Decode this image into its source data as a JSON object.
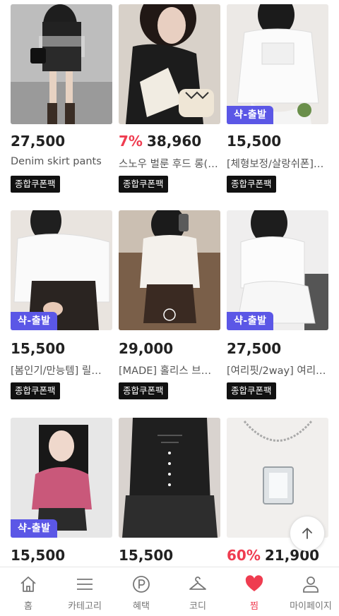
{
  "products": [
    {
      "price": "27,500",
      "discount": "",
      "title": "Denim skirt pants",
      "coupon": "종합쿠폰팩",
      "badge": ""
    },
    {
      "price": "38,960",
      "discount": "7%",
      "title": "스노우 벌룬 후드 롱(…",
      "coupon": "종합쿠폰팩",
      "badge": ""
    },
    {
      "price": "15,500",
      "discount": "",
      "title": "[체형보정/살랑쉬폰]…",
      "coupon": "종합쿠폰팩",
      "badge": "샥-출발"
    },
    {
      "price": "15,500",
      "discount": "",
      "title": "[봄인기/만능템] 릴…",
      "coupon": "종합쿠폰팩",
      "badge": "샥-출발"
    },
    {
      "price": "29,000",
      "discount": "",
      "title": "[MADE] 홀리스 브…",
      "coupon": "종합쿠폰팩",
      "badge": ""
    },
    {
      "price": "27,500",
      "discount": "",
      "title": "[여리핏/2way] 여리…",
      "coupon": "종합쿠폰팩",
      "badge": "샥-출발"
    },
    {
      "price": "15,500",
      "discount": "",
      "title": "",
      "coupon": "",
      "badge": "샥-출발"
    },
    {
      "price": "15,500",
      "discount": "",
      "title": "",
      "coupon": "",
      "badge": ""
    },
    {
      "price": "21,900",
      "discount": "60%",
      "title": "",
      "coupon": "",
      "badge": ""
    }
  ],
  "tabbar": {
    "items": [
      {
        "label": "홈",
        "icon": "home-icon"
      },
      {
        "label": "카테고리",
        "icon": "menu-icon"
      },
      {
        "label": "혜택",
        "icon": "point-icon"
      },
      {
        "label": "코디",
        "icon": "hanger-icon"
      },
      {
        "label": "찜",
        "icon": "heart-icon",
        "active": true
      },
      {
        "label": "마이페이지",
        "icon": "person-icon"
      }
    ]
  },
  "colors": {
    "accent": "#ef3c50",
    "badge": "#5b57e6",
    "coupon_bg": "#111111"
  }
}
